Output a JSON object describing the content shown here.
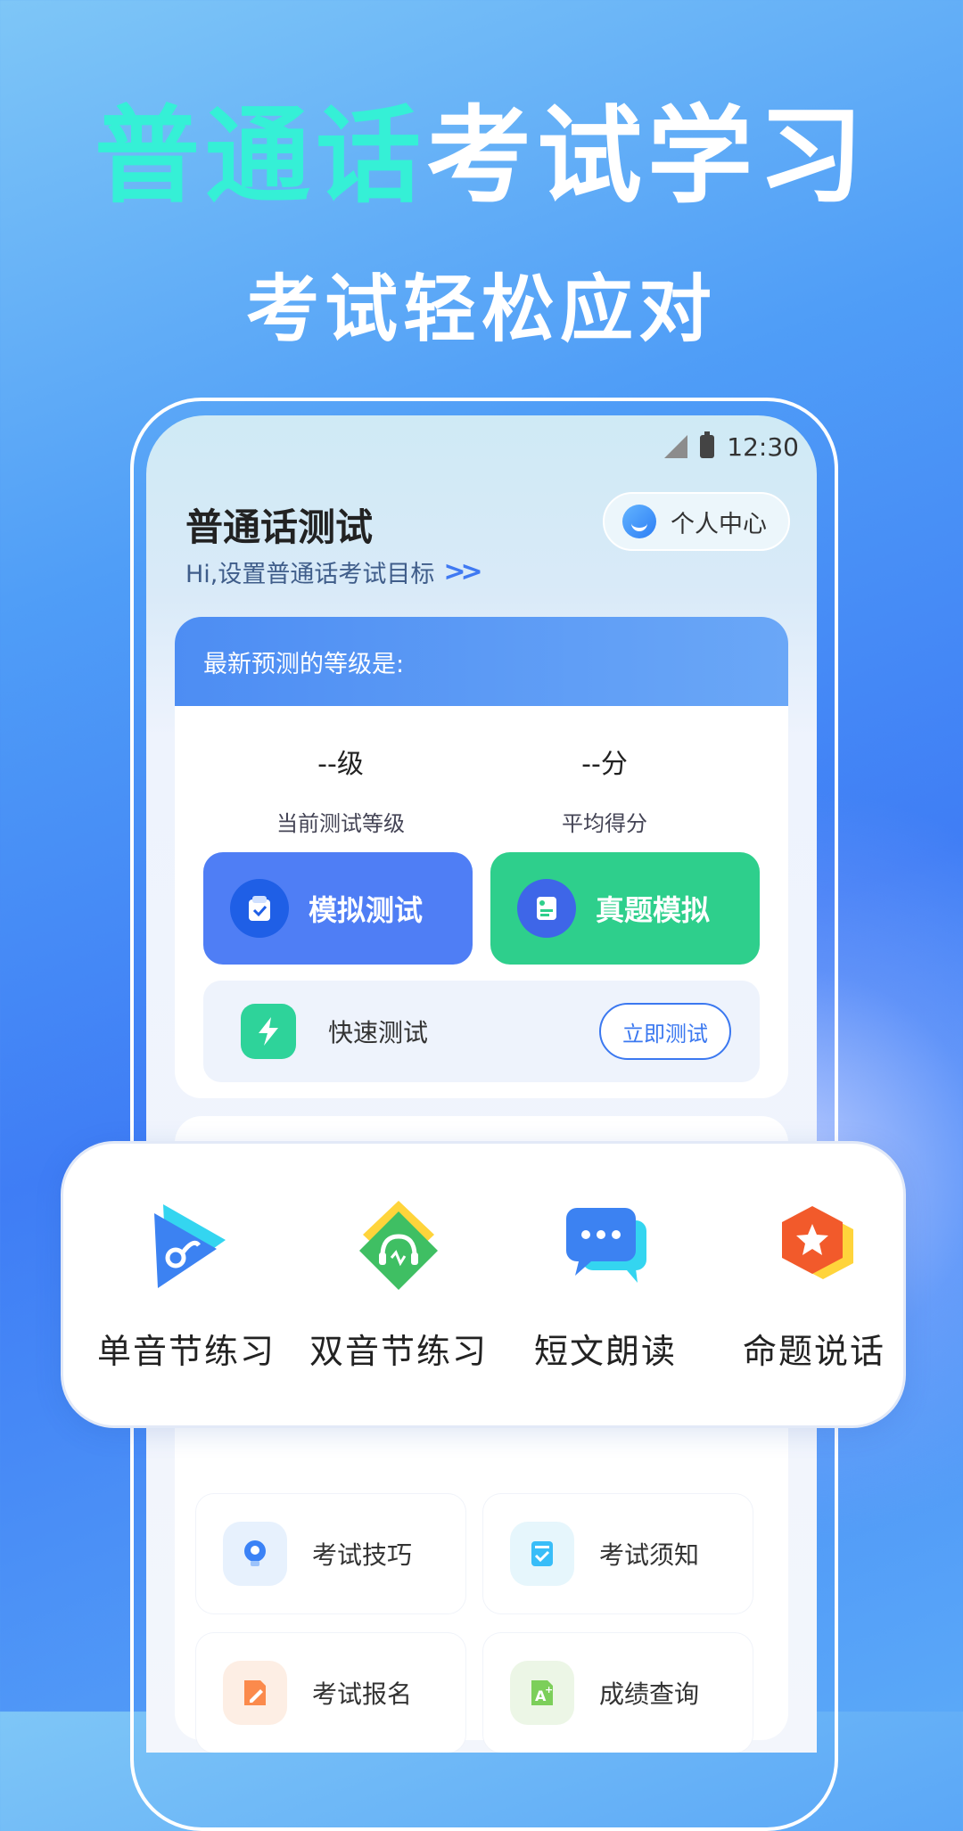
{
  "headline": {
    "highlight": "普通话",
    "rest": "考试学习",
    "subtitle": "考试轻松应对"
  },
  "status_bar": {
    "time": "12:30"
  },
  "header": {
    "title": "普通话测试",
    "subtitle": "Hi,设置普通话考试目标",
    "personal_center": "个人中心"
  },
  "prediction": {
    "heading": "最新预测的等级是:",
    "level_value": "--级",
    "level_label": "当前测试等级",
    "score_value": "--分",
    "score_label": "平均得分"
  },
  "actions": {
    "mock_test": "模拟测试",
    "real_exam": "真题模拟",
    "quick_test": "快速测试",
    "test_now": "立即测试"
  },
  "features": [
    {
      "label": "单音节练习",
      "icon": "play-icon"
    },
    {
      "label": "双音节练习",
      "icon": "headphones-icon"
    },
    {
      "label": "短文朗读",
      "icon": "chat-icon"
    },
    {
      "label": "命题说话",
      "icon": "star-hexagon-icon"
    }
  ],
  "tools": [
    {
      "label": "考试技巧",
      "icon": "lightbulb-icon"
    },
    {
      "label": "考试须知",
      "icon": "checklist-icon"
    },
    {
      "label": "考试报名",
      "icon": "edit-doc-icon"
    },
    {
      "label": "成绩查询",
      "icon": "grade-doc-icon"
    }
  ],
  "colors": {
    "accent": "#3f7df5",
    "highlight": "#35f0d6",
    "green": "#2ed39a",
    "blue_button": "#4f7ef5"
  }
}
